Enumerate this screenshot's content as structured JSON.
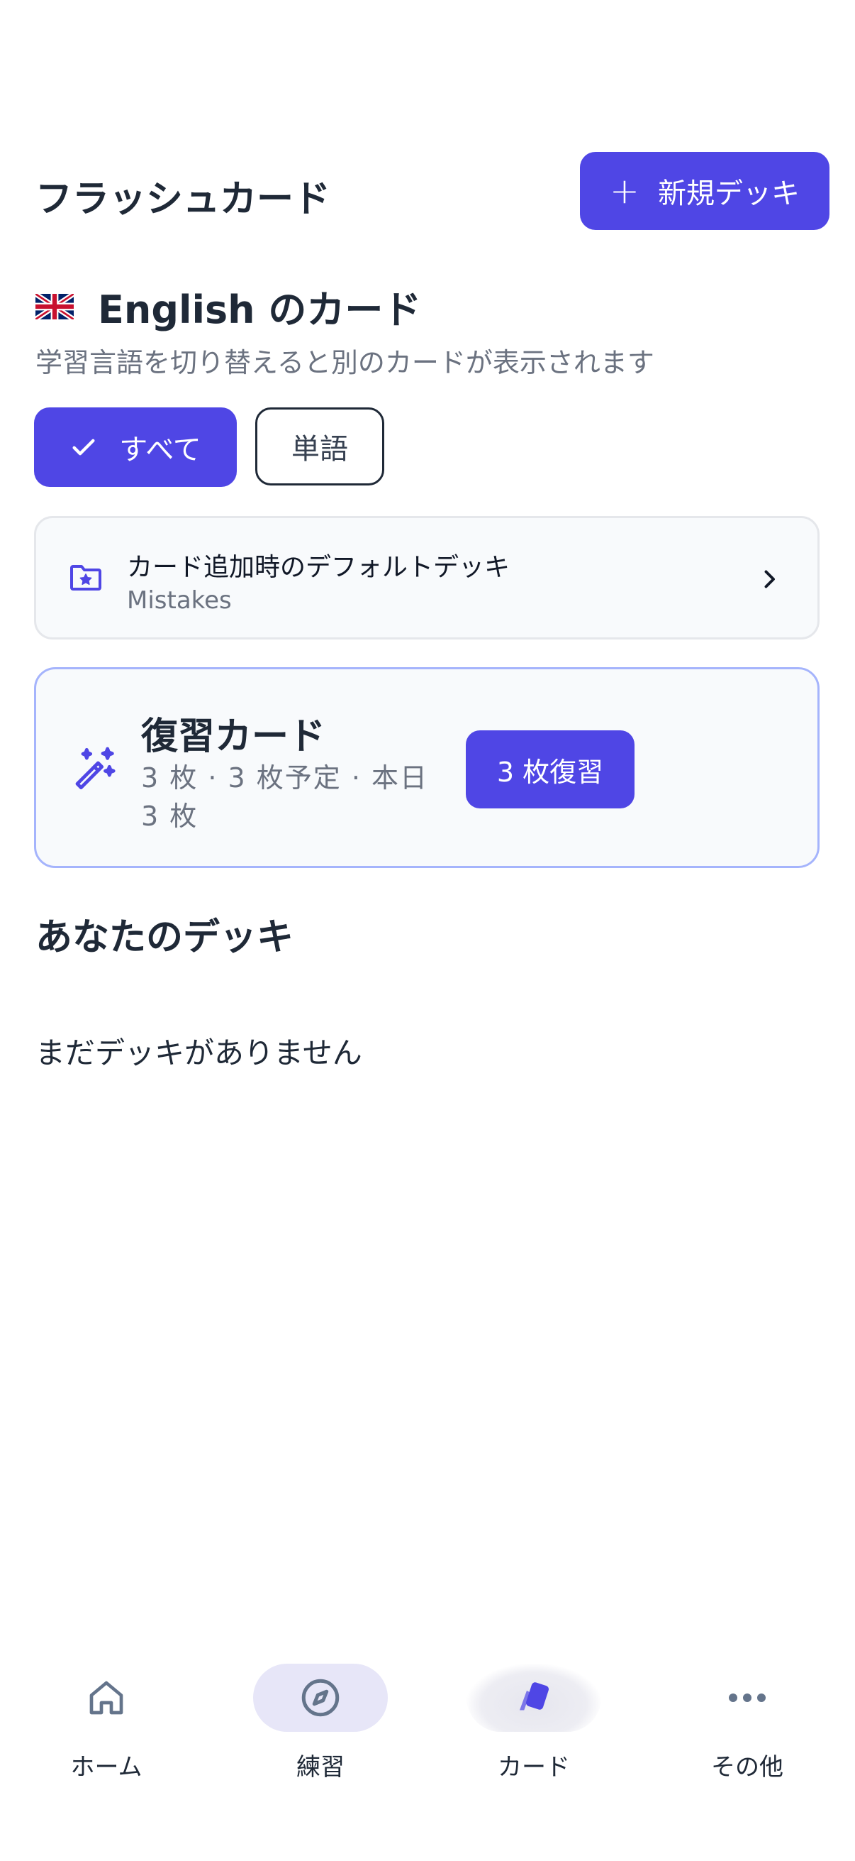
{
  "header": {
    "title": "フラッシュカード",
    "new_deck_label": "新規デッキ"
  },
  "language": {
    "title": "English のカード",
    "subtitle": "学習言語を切り替えると別のカードが表示されます"
  },
  "filters": {
    "all_label": "すべて",
    "word_label": "単語",
    "selected": "すべて"
  },
  "default_deck": {
    "title": "カード追加時のデフォルトデッキ",
    "value": "Mistakes"
  },
  "review": {
    "title": "復習カード",
    "subtitle": "3 枚 · 3 枚予定 · 本日 3 枚",
    "button_label": "3 枚復習"
  },
  "decks": {
    "section_title": "あなたのデッキ",
    "empty_text": "まだデッキがありません"
  },
  "bottom_nav": {
    "items": [
      {
        "label": "ホーム",
        "icon": "home-icon"
      },
      {
        "label": "練習",
        "icon": "compass-icon"
      },
      {
        "label": "カード",
        "icon": "cards-icon"
      },
      {
        "label": "その他",
        "icon": "more-icon"
      }
    ],
    "active": "カード"
  },
  "colors": {
    "accent": "#4f46e5",
    "text": "#1f2937",
    "muted": "#6b7280"
  }
}
